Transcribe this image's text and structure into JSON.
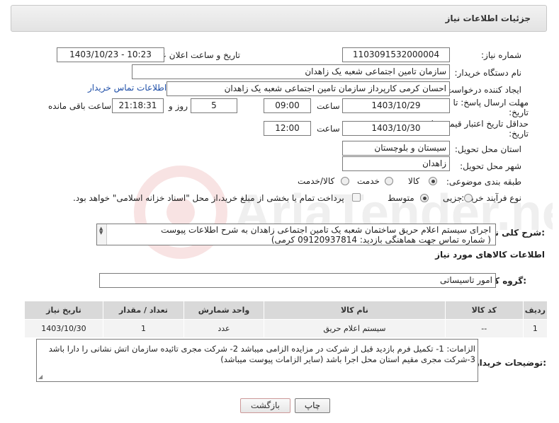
{
  "header": {
    "title": "جزئیات اطلاعات نیاز"
  },
  "form": {
    "need_number_label": "شماره نیاز:",
    "need_number": "1103091532000004",
    "announce_label": "تاریخ و ساعت اعلان عمومی:",
    "announce_value": "1403/10/23 - 10:23",
    "buyer_org_label": "نام دستگاه خریدار:",
    "buyer_org": "سازمان تامین اجتماعی شعبه یک زاهدان",
    "creator_label": "ایجاد کننده درخواست:",
    "creator": "احسان کرمی کارپرداز سازمان تامین اجتماعی شعبه یک زاهدان",
    "contact_link": "اطلاعات تماس خریدار",
    "deadline_label_1": "مهلت ارسال پاسخ: تا",
    "deadline_label_2": "تاریخ:",
    "deadline_date": "1403/10/29",
    "time_label": "ساعت",
    "deadline_time": "09:00",
    "days_value": "5",
    "days_label": "روز و",
    "remaining_time": "21:18:31",
    "remaining_label": "ساعت باقی مانده",
    "validity_label_1": "حداقل تاریخ اعتبار قیمت: تا",
    "validity_label_2": "تاریخ:",
    "validity_date": "1403/10/30",
    "validity_time_label": "ساعت",
    "validity_time": "12:00",
    "province_label": "استان محل تحویل:",
    "province": "سیستان و بلوچستان",
    "city_label": "شهر محل تحویل:",
    "city": "زاهدان",
    "category_label": "طبقه بندی موضوعی:",
    "category_options": [
      "کالا",
      "خدمت",
      "کالا/خدمت"
    ],
    "process_label": "نوع فرآیند خرید :",
    "process_options": [
      "جزیی",
      "متوسط"
    ],
    "payment_note": "پرداخت تمام یا بخشی از مبلغ خرید،از محل \"اسناد خزانه اسلامی\" خواهد بود.",
    "description_label": "شرح کلی نیاز:",
    "description_line1": "اجرای سیستم اعلام حریق ساختمان شعبه یک تامین اجتماعی زاهدان به شرح اطلاعات پیوست",
    "description_line2": "( شماره تماس جهت هماهنگی بازدید: 09120937814 کرمی)"
  },
  "goods": {
    "section_title": "اطلاعات کالاهای مورد نیاز",
    "group_label": "گروه کالا:",
    "group_value": "امور تاسیساتی",
    "table": {
      "headers": [
        "ردیف",
        "کد کالا",
        "نام کالا",
        "واحد شمارش",
        "تعداد / مقدار",
        "تاریخ نیاز"
      ],
      "rows": [
        [
          "1",
          "--",
          "سیستم اعلام حریق",
          "عدد",
          "1",
          "1403/10/30"
        ]
      ]
    }
  },
  "notes": {
    "label": "توضیحات خریدار:",
    "line1": "الزامات: 1- تکمیل فرم بازدید قبل از شرکت در مزایده الزامی میباشد  2- شرکت مجری تائیده سازمان اتش نشانی را دارا باشد",
    "line2": "3-شرکت مجری مقیم استان محل اجرا باشد  (سایر الزامات پیوست میباشد)"
  },
  "buttons": {
    "print": "چاپ",
    "back": "بازگشت"
  },
  "watermark": {
    "text": "AriaTender.neT"
  }
}
